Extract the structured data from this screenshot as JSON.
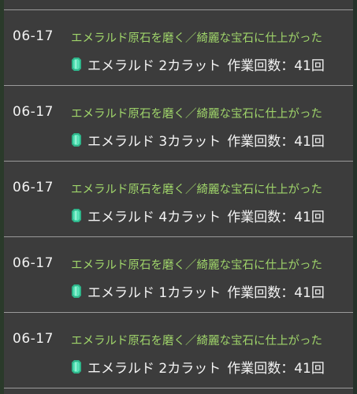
{
  "colors": {
    "background": "#3c3c3c",
    "action_text": "#9fd46a",
    "date_text": "#f2f2f2",
    "divider": "#9a9a9a",
    "gem": "#3ecfa0"
  },
  "entries": [
    {
      "date": "06-17",
      "action": "エメラルド原石を磨く／綺麗な宝石に仕上がった",
      "item": "エメラルド 2カラット",
      "count_label": "作業回数：41回",
      "icon": "emerald-gem-icon"
    },
    {
      "date": "06-17",
      "action": "エメラルド原石を磨く／綺麗な宝石に仕上がった",
      "item": "エメラルド 3カラット",
      "count_label": "作業回数：41回",
      "icon": "emerald-gem-icon"
    },
    {
      "date": "06-17",
      "action": "エメラルド原石を磨く／綺麗な宝石に仕上がった",
      "item": "エメラルド 4カラット",
      "count_label": "作業回数：41回",
      "icon": "emerald-gem-icon"
    },
    {
      "date": "06-17",
      "action": "エメラルド原石を磨く／綺麗な宝石に仕上がった",
      "item": "エメラルド 1カラット",
      "count_label": "作業回数：41回",
      "icon": "emerald-gem-icon"
    },
    {
      "date": "06-17",
      "action": "エメラルド原石を磨く／綺麗な宝石に仕上がった",
      "item": "エメラルド 2カラット",
      "count_label": "作業回数：41回",
      "icon": "emerald-gem-icon"
    }
  ]
}
